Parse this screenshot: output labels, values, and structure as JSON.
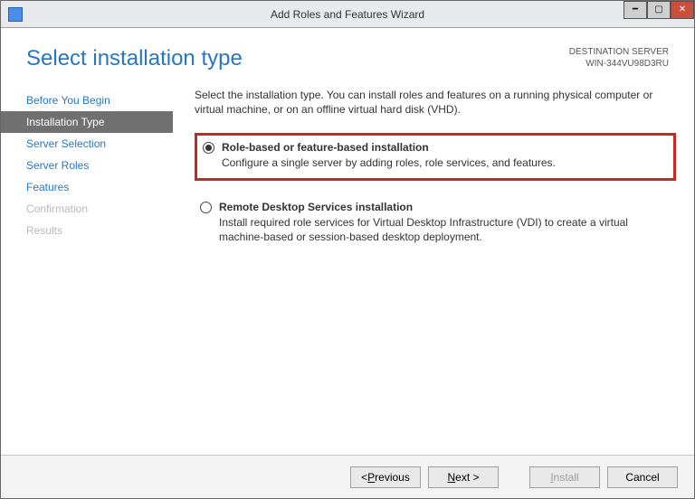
{
  "window": {
    "title": "Add Roles and Features Wizard"
  },
  "header": {
    "page_title": "Select installation type",
    "destination_label": "DESTINATION SERVER",
    "destination_server": "WIN-344VU98D3RU"
  },
  "sidebar": {
    "items": [
      {
        "label": "Before You Begin",
        "state": "normal"
      },
      {
        "label": "Installation Type",
        "state": "active"
      },
      {
        "label": "Server Selection",
        "state": "normal"
      },
      {
        "label": "Server Roles",
        "state": "normal"
      },
      {
        "label": "Features",
        "state": "normal"
      },
      {
        "label": "Confirmation",
        "state": "disabled"
      },
      {
        "label": "Results",
        "state": "disabled"
      }
    ]
  },
  "main": {
    "intro": "Select the installation type. You can install roles and features on a running physical computer or virtual machine, or on an offline virtual hard disk (VHD).",
    "options": [
      {
        "title": "Role-based or feature-based installation",
        "desc": "Configure a single server by adding roles, role services, and features.",
        "selected": true,
        "highlighted": true
      },
      {
        "title": "Remote Desktop Services installation",
        "desc": "Install required role services for Virtual Desktop Infrastructure (VDI) to create a virtual machine-based or session-based desktop deployment.",
        "selected": false,
        "highlighted": false
      }
    ]
  },
  "footer": {
    "previous": "< Previous",
    "next": "Next >",
    "install": "Install",
    "cancel": "Cancel"
  }
}
